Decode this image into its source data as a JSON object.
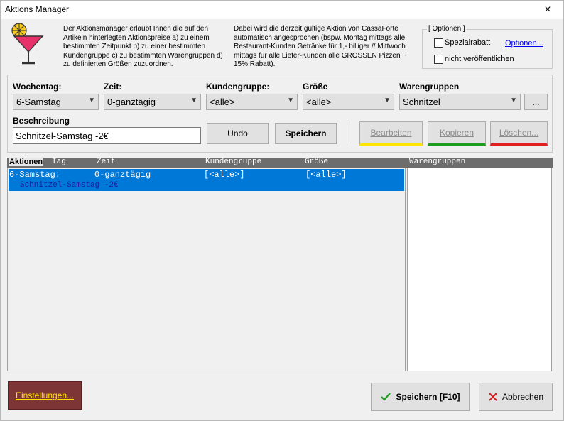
{
  "window": {
    "title": "Aktions Manager",
    "close_icon": "×"
  },
  "info": {
    "left_text": "Der Aktionsmanager erlaubt Ihnen die auf den Artikeln hinterlegten Aktionspreise a) zu einem bestimmten Zeitpunkt b) zu einer bestimmten Kundengruppe c) zu bestimmten Warengruppen d) zu definierten Größen zuzuordnen.",
    "right_text": "Dabei wird die derzeit gültige Aktion von CassaForte automatisch angesprochen (bspw. Montag mittags alle Restaurant-Kunden Getränke für 1,- billiger // Mittwoch mittags für alle Liefer-Kunden alle GROSSEN Pizzen ~ 15% Rabatt)."
  },
  "options": {
    "legend": "[ Optionen ]",
    "spezialrabatt_label": "Spezialrabatt",
    "spezialrabatt_checked": false,
    "optionen_link": "Optionen...",
    "nicht_veroeffentlichen_label": "nicht veröffentlichen",
    "nicht_veroeffentlichen_checked": false
  },
  "filters": {
    "wochentag_label": "Wochentag:",
    "wochentag_value": "6-Samstag",
    "zeit_label": "Zeit:",
    "zeit_value": "0-ganztägig",
    "kundengruppe_label": "Kundengruppe:",
    "kundengruppe_value": "<alle>",
    "groesse_label": "Größe",
    "groesse_value": "<alle>",
    "warengruppen_label": "Warengruppen",
    "warengruppen_value": "Schnitzel",
    "ellipsis_label": "..."
  },
  "beschreibung": {
    "label": "Beschreibung",
    "value": "Schnitzel-Samstag -2€"
  },
  "actions": {
    "undo": "Undo",
    "speichern": "Speichern",
    "bearbeiten": "Bearbeiten",
    "kopieren": "Kopieren",
    "loeschen": "Löschen...",
    "bearbeiten_color": "#ffe400",
    "kopieren_color": "#1e9e1e",
    "loeschen_color": "#e11f1f"
  },
  "grid": {
    "headers": {
      "aktionen": "Aktionen",
      "tag": "Tag",
      "zeit": "Zeit",
      "kundengruppe": "Kundengruppe",
      "groesse": "Größe",
      "warengruppen": "Warengruppen"
    },
    "rows": [
      {
        "tag": "6-Samstag:",
        "zeit": "0-ganztägig",
        "kundengruppe": "[<alle>]",
        "groesse": "[<alle>]",
        "beschreibung": "Schnitzel-Samstag -2€"
      }
    ],
    "selection_color": "#0078d7"
  },
  "bottom": {
    "einstellungen": "Einstellungen...",
    "einstellungen_bg": "#7d3535",
    "speichern_f10": "Speichern [F10]",
    "abbrechen": "Abbrechen",
    "check_icon": "check-icon",
    "cancel_icon": "cross-icon"
  }
}
